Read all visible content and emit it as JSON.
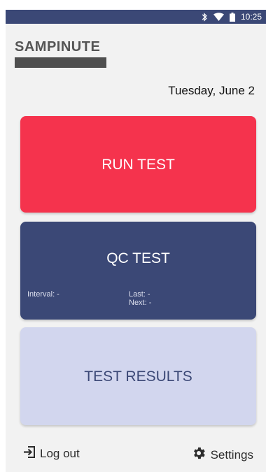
{
  "status_bar": {
    "time": "10:25",
    "icons": [
      "bluetooth-icon",
      "wifi-icon",
      "battery-icon"
    ],
    "color": "#3b4876"
  },
  "header": {
    "logo_text": "SAMPINUTE",
    "date": "Tuesday, June 2"
  },
  "cards": {
    "run_test": {
      "label": "RUN TEST",
      "color": "#f5334d"
    },
    "qc_test": {
      "label": "QC TEST",
      "color": "#3b4876",
      "interval": "Interval: -",
      "last": "Last: -",
      "next": "Next: -"
    },
    "test_results": {
      "label": "TEST RESULTS",
      "color": "#d2d6ee"
    }
  },
  "footer": {
    "logout_label": "Log out",
    "logout_icon": "logout-icon",
    "settings_label": "Settings",
    "settings_icon": "gear-icon"
  }
}
